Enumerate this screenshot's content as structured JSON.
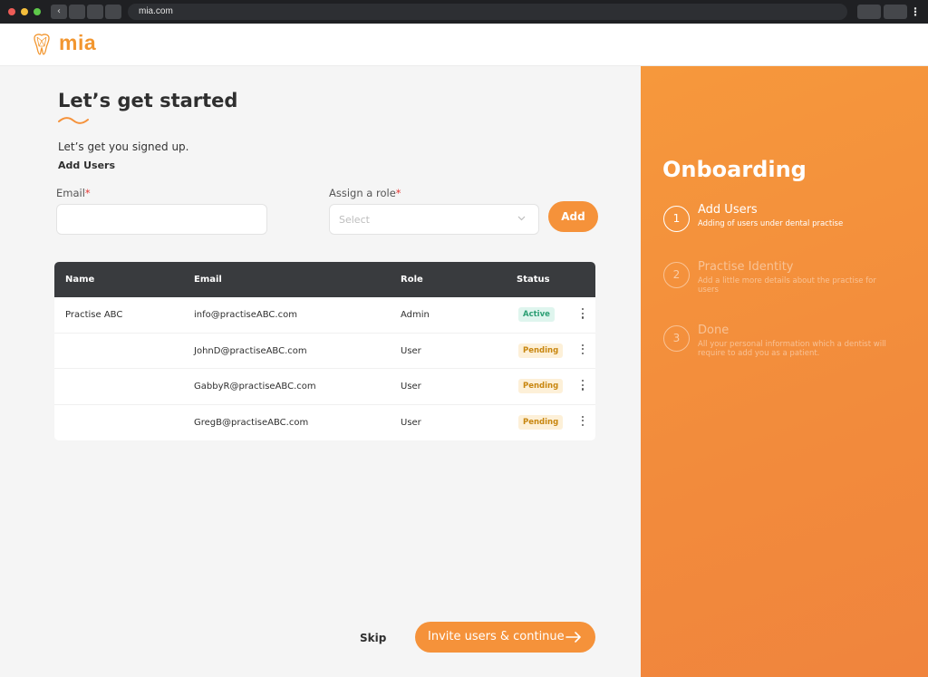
{
  "browser": {
    "url": "mia.com",
    "back_icon": "‹"
  },
  "header": {
    "brand": "mia",
    "logo_icon": "tooth-logo-icon"
  },
  "main": {
    "title": "Let’s get started",
    "subtitle": "Let’s get you signed up.",
    "section": "Add Users",
    "email_label": "Email",
    "email_value": "",
    "role_label": "Assign a role",
    "required_mark": "*",
    "role_placeholder": "Select",
    "add_label": "Add",
    "skip_label": "Skip",
    "continue_label": "Invite users & continue"
  },
  "table": {
    "headers": [
      "Name",
      "Email",
      "Role",
      "Status"
    ],
    "rows": [
      {
        "name": "Practise ABC",
        "email": "info@practiseABC.com",
        "role": "Admin",
        "status": "Active"
      },
      {
        "name": "",
        "email": "JohnD@practiseABC.com",
        "role": "User",
        "status": "Pending"
      },
      {
        "name": "",
        "email": "GabbyR@practiseABC.com",
        "role": "User",
        "status": "Pending"
      },
      {
        "name": "",
        "email": "GregB@practiseABC.com",
        "role": "User",
        "status": "Pending"
      }
    ]
  },
  "onboarding": {
    "title": "Onboarding",
    "steps": [
      {
        "num": "1",
        "title": "Add Users",
        "desc": "Adding of users under dental practise",
        "active": true
      },
      {
        "num": "2",
        "title": "Practise Identity",
        "desc": "Add a little more details about the practise for users",
        "active": false
      },
      {
        "num": "3",
        "title": "Done",
        "desc": "All your personal information which a dentist will require to add you as a patient.",
        "active": false
      }
    ]
  },
  "colors": {
    "accent": "#f5923a",
    "active_badge": "#2c9f74",
    "pending_badge": "#c8860f",
    "table_header": "#393b3e"
  }
}
